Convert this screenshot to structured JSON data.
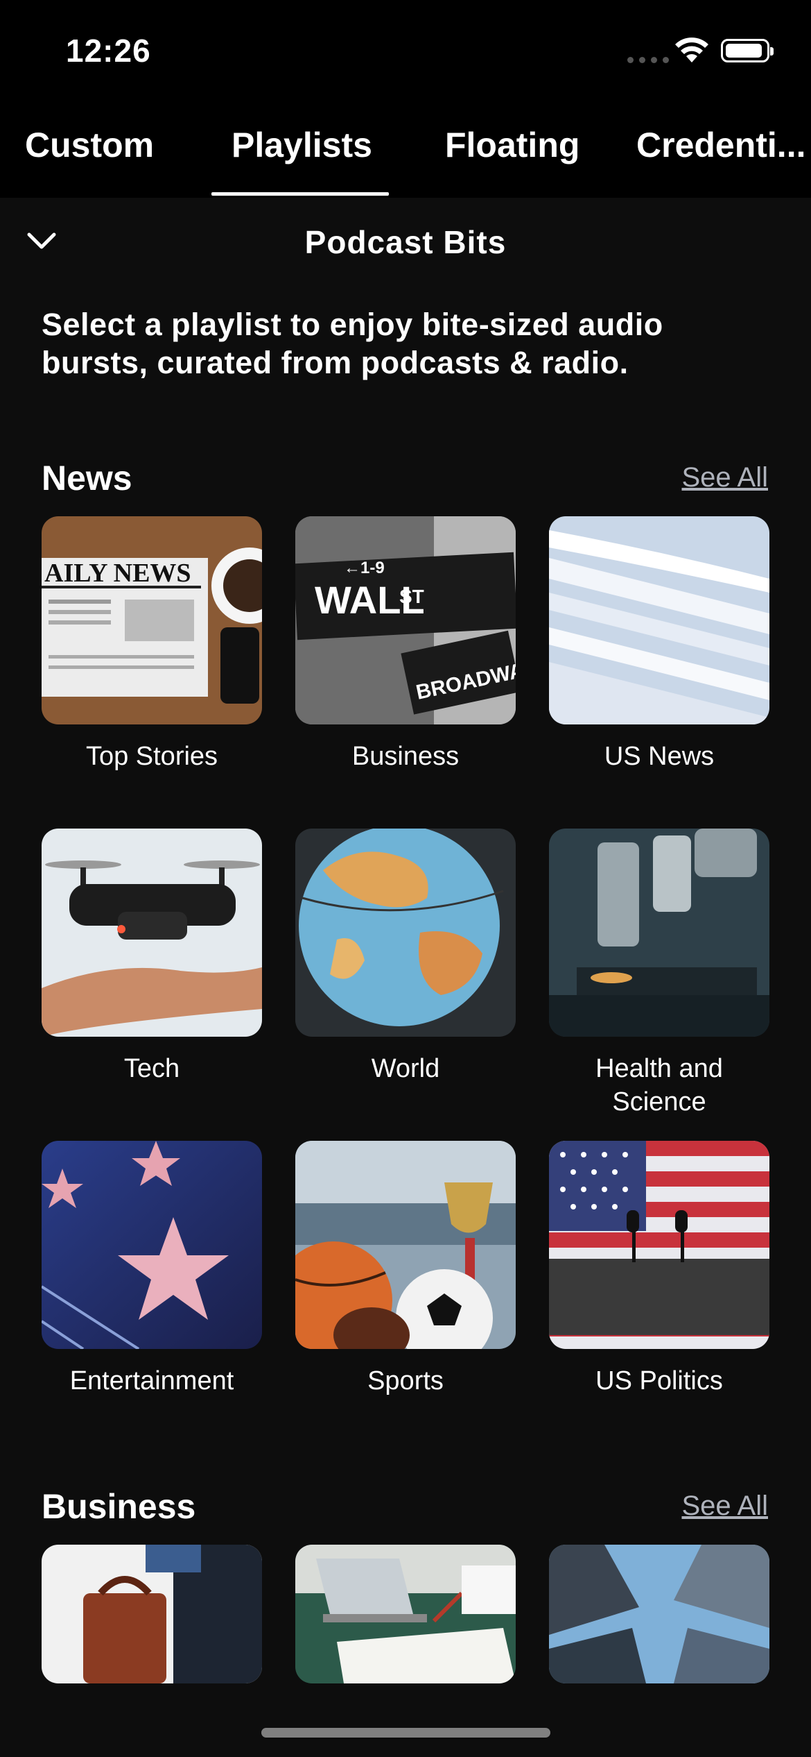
{
  "status_bar": {
    "time": "12:26"
  },
  "tabs": [
    {
      "label": "Custom"
    },
    {
      "label": "Playlists",
      "active": true
    },
    {
      "label": "Floating"
    },
    {
      "label": "Credenti..."
    }
  ],
  "header": {
    "title": "Podcast Bits"
  },
  "intro": "Select a playlist to enjoy bite-sized audio bursts, curated from podcasts & radio.",
  "sections": [
    {
      "title": "News",
      "see_all": "See All",
      "items": [
        {
          "label": "Top Stories",
          "icon": "newspaper-image"
        },
        {
          "label": "Business",
          "icon": "wall-street-sign-image"
        },
        {
          "label": "US News",
          "icon": "newspapers-stack-image"
        },
        {
          "label": "Tech",
          "icon": "drone-image"
        },
        {
          "label": "World",
          "icon": "globe-image"
        },
        {
          "label": "Health and Science",
          "icon": "microscope-image"
        },
        {
          "label": "Entertainment",
          "icon": "walk-of-fame-star-image"
        },
        {
          "label": "Sports",
          "icon": "sports-balls-trophy-image"
        },
        {
          "label": "US Politics",
          "icon": "flag-podium-image"
        }
      ]
    },
    {
      "title": "Business",
      "see_all": "See All",
      "items": [
        {
          "icon": "briefcase-image"
        },
        {
          "icon": "laptop-paperwork-image"
        },
        {
          "icon": "skyscrapers-image"
        }
      ]
    }
  ]
}
